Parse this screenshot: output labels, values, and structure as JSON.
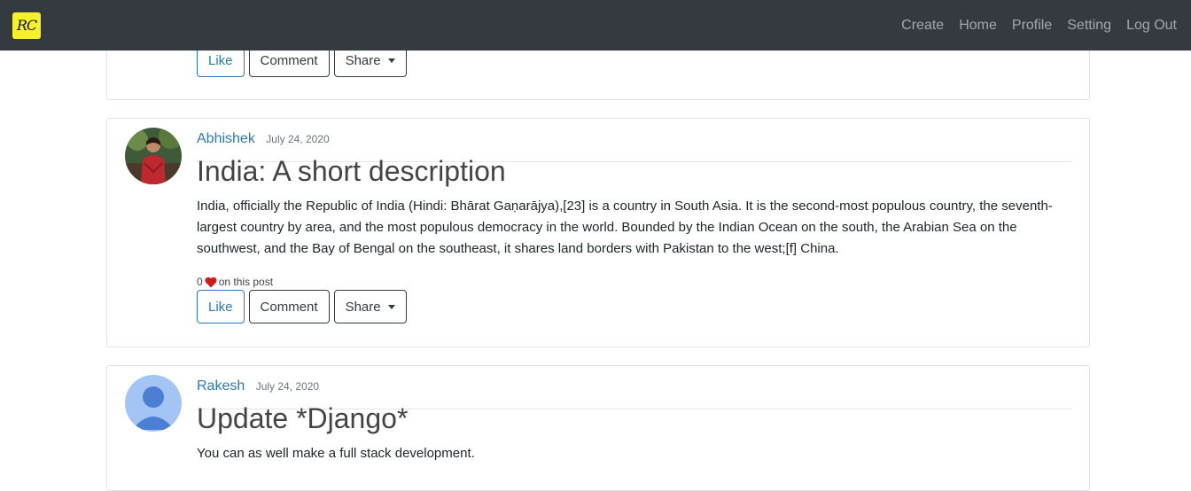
{
  "navbar": {
    "brand": "RC",
    "links": [
      "Create",
      "Home",
      "Profile",
      "Setting",
      "Log Out"
    ]
  },
  "posts": [
    {
      "actions": {
        "like": "Like",
        "comment": "Comment",
        "share": "Share"
      }
    },
    {
      "author": "Abhishek",
      "date": "July 24, 2020",
      "title": "India: A short description",
      "content": "India, officially the Republic of India (Hindi: Bhārat Gaṇarājya),[23] is a country in South Asia. It is the second-most populous country, the seventh-largest country by area, and the most populous democracy in the world. Bounded by the Indian Ocean on the south, the Arabian Sea on the southwest, and the Bay of Bengal on the southeast, it shares land borders with Pakistan to the west;[f] China.",
      "like_count": "0",
      "likes_suffix": "on this post",
      "actions": {
        "like": "Like",
        "comment": "Comment",
        "share": "Share"
      }
    },
    {
      "author": "Rakesh",
      "date": "July 24, 2020",
      "title": "Update *Django*",
      "content": "You can as well make a full stack development."
    }
  ],
  "icons": {
    "like": "heart-icon",
    "share": "caret-down-icon"
  },
  "colors": {
    "navbar": "#343a40",
    "brand_bg": "#f7f12a",
    "link": "#2a79b3",
    "heart": "#d11a1a"
  }
}
